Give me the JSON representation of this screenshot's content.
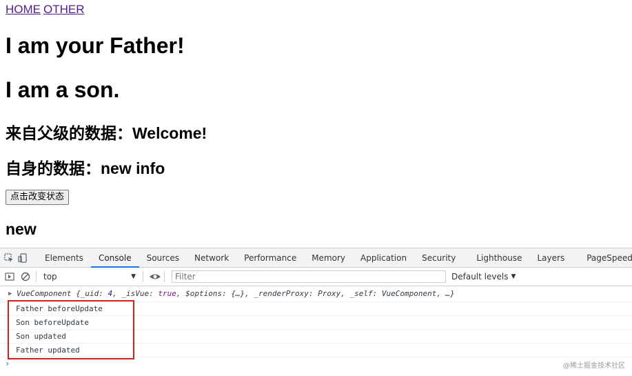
{
  "nav": {
    "home": "HOME",
    "other": "OTHER"
  },
  "page": {
    "father_heading": "I am your Father!",
    "son_heading": "I am a son.",
    "parent_data": "来自父级的数据：Welcome!",
    "own_data": "自身的数据：new info",
    "change_button": "点击改变状态",
    "status": "new"
  },
  "devtools": {
    "tabs": [
      "Elements",
      "Console",
      "Sources",
      "Network",
      "Performance",
      "Memory",
      "Application",
      "Security",
      "Lighthouse",
      "Layers",
      "PageSpeed"
    ],
    "active_tab": "Console",
    "context": "top",
    "filter_placeholder": "Filter",
    "levels": "Default levels"
  },
  "console": {
    "object_line": {
      "name": "VueComponent",
      "p1": " {_uid: ",
      "uid": "4",
      "p2": ", _isVue: ",
      "isvue": "true",
      "p3": ", $options: {…}, _renderProxy: Proxy, _self: VueComponent, …}"
    },
    "logs": [
      "Father beforeUpdate",
      "Son beforeUpdate",
      "Son updated",
      "Father updated"
    ]
  },
  "watermark": "@稀土掘金技术社区",
  "colors": {
    "accent": "#1a73e8",
    "highlight": "#d61c1c",
    "link": "#551a8b"
  }
}
